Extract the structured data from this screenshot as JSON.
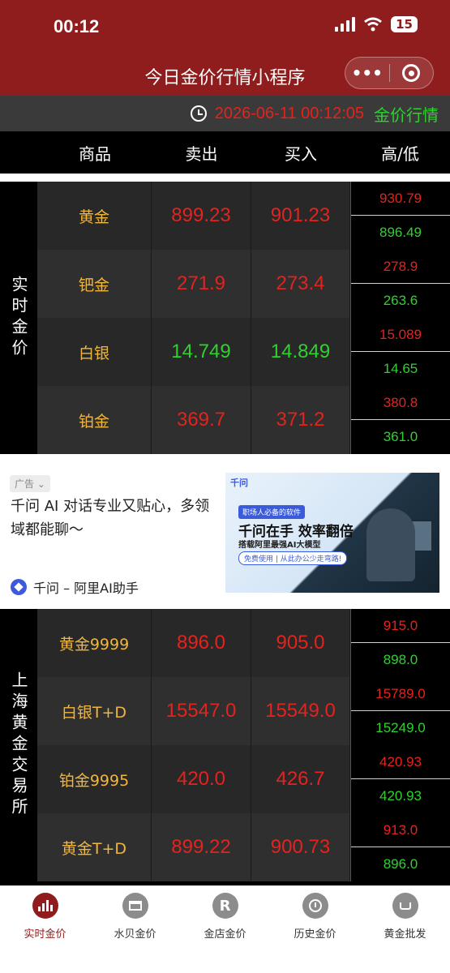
{
  "status_bar": {
    "time": "00:12",
    "battery": "15"
  },
  "nav": {
    "title": "今日金价行情小程序",
    "more_icon": "•••"
  },
  "datebar": {
    "datetime": "2026-06-11 00:12:05",
    "label": "金价行情"
  },
  "table_header": {
    "name": "商品",
    "sell": "卖出",
    "buy": "买入",
    "high_low": "高/低"
  },
  "realtime": {
    "label": "实时金价",
    "rows": [
      {
        "name": "黄金",
        "sell": "899.23",
        "buy": "901.23",
        "high": "930.79",
        "low": "896.49",
        "sell_trend": "up",
        "buy_trend": "up"
      },
      {
        "name": "钯金",
        "sell": "271.9",
        "buy": "273.4",
        "high": "278.9",
        "low": "263.6",
        "sell_trend": "up",
        "buy_trend": "up"
      },
      {
        "name": "白银",
        "sell": "14.749",
        "buy": "14.849",
        "high": "15.089",
        "low": "14.65",
        "sell_trend": "down",
        "buy_trend": "down"
      },
      {
        "name": "铂金",
        "sell": "369.7",
        "buy": "371.2",
        "high": "380.8",
        "low": "361.0",
        "sell_trend": "up",
        "buy_trend": "up"
      }
    ]
  },
  "ad": {
    "tag": "广告",
    "text": "千问 AI 对话专业又贴心，多领域都能聊～",
    "brand": "千问 – 阿里AI助手",
    "banner_brand": "千问",
    "banner_chip": "职场人必备的软件",
    "banner_headline": "千问在手 效率翻倍",
    "banner_sub": "搭载阿里最强AI大模型",
    "banner_btn": "免费使用 | 从此办公少走弯路!"
  },
  "sge": {
    "label": "上海黄金交易所",
    "rows": [
      {
        "name": "黄金9999",
        "sell": "896.0",
        "buy": "905.0",
        "high": "915.0",
        "low": "898.0",
        "sell_trend": "up",
        "buy_trend": "up"
      },
      {
        "name": "白银T+D",
        "sell": "15547.0",
        "buy": "15549.0",
        "high": "15789.0",
        "low": "15249.0",
        "sell_trend": "up",
        "buy_trend": "up"
      },
      {
        "name": "铂金9995",
        "sell": "420.0",
        "buy": "426.7",
        "high": "420.93",
        "low": "420.93",
        "sell_trend": "up",
        "buy_trend": "up"
      },
      {
        "name": "黄金T+D",
        "sell": "899.22",
        "buy": "900.73",
        "high": "913.0",
        "low": "896.0",
        "sell_trend": "up",
        "buy_trend": "up"
      }
    ]
  },
  "tabs": [
    {
      "label": "实时金价",
      "icon": "bar-chart-icon",
      "active": true
    },
    {
      "label": "水贝金价",
      "icon": "shop-icon",
      "active": false
    },
    {
      "label": "金店金价",
      "icon": "r-badge-icon",
      "active": false
    },
    {
      "label": "历史金价",
      "icon": "history-icon",
      "active": false
    },
    {
      "label": "黄金批发",
      "icon": "cart-icon",
      "active": false
    }
  ],
  "colors": {
    "brand": "#8f1d1d",
    "up": "#e3231e",
    "down": "#2fd12f",
    "name": "#f2b63a"
  }
}
